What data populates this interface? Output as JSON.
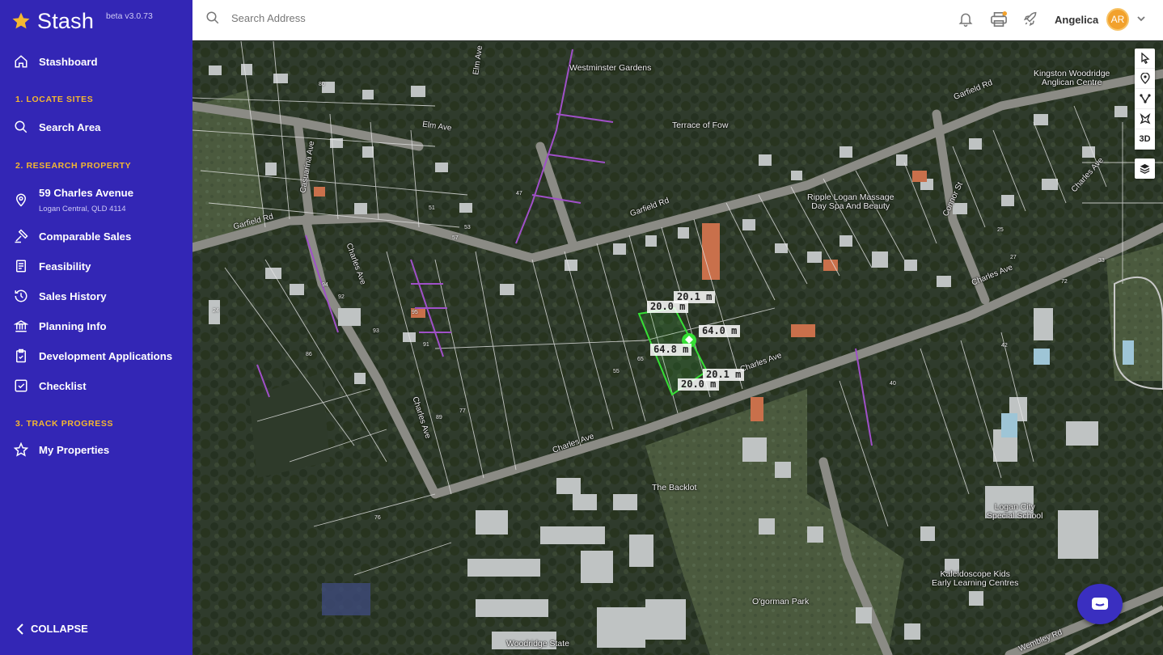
{
  "brand": {
    "name": "Stash",
    "version": "beta v3.0.73"
  },
  "sidebar": {
    "dashboard": "Stashboard",
    "section1": "1. LOCATE SITES",
    "search_area": "Search Area",
    "section2": "2. RESEARCH PROPERTY",
    "property_title": "59 Charles Avenue",
    "property_sub": "Logan Central, QLD 4114",
    "comparable": "Comparable Sales",
    "feasibility": "Feasibility",
    "sales_history": "Sales History",
    "planning": "Planning Info",
    "dev_apps": "Development Applications",
    "checklist": "Checklist",
    "section3": "3. TRACK PROGRESS",
    "my_properties": "My Properties",
    "collapse": "COLLAPSE"
  },
  "topbar": {
    "search_placeholder": "Search Address",
    "user_name": "Angelica",
    "avatar_initials": "AR"
  },
  "map": {
    "toolbar": {
      "three_d": "3D"
    },
    "measurements": {
      "top": "20.1 m",
      "top_left": "20.0 m",
      "right": "64.0 m",
      "left": "64.8 m",
      "bottom_right": "20.1 m",
      "bottom": "20.0 m"
    },
    "roads": {
      "elm_ave": "Elm Ave",
      "elm_ave_v": "Elm Ave",
      "casuarina": "Casuarina Ave",
      "garfield_rd_left": "Garfield Rd",
      "garfield_rd_mid": "Garfield Rd",
      "garfield_rd_right": "Garfield Rd",
      "charles_ave_v": "Charles Ave",
      "charles_ave_v2": "Charles Ave",
      "charles_ave_main": "Charles Ave",
      "charles_ave_mid": "Charles Ave",
      "charles_ave_right": "Charles Ave",
      "charles_ave_far": "Charles Ave",
      "connor_st": "Connor St",
      "wembley_rd": "Wembley Rd"
    },
    "pois": {
      "westminster": "Westminster Gardens",
      "terrace": "Terrace of Fow",
      "ripple": "Ripple Logan Massage\nDay Spa And Beauty",
      "kingston": "Kingston Woodridge\nAnglican Centre",
      "backlot": "The Backlot",
      "special_school": "Logan City\nSpecial School",
      "kaleidoscope": "Kaleidoscope Kids\nEarly Learning Centres",
      "ogorman": "O'gorman Park",
      "woodridge": "Woodridge State"
    },
    "lot_numbers": [
      "57",
      "53",
      "55",
      "65",
      "63",
      "86",
      "89",
      "77",
      "72",
      "24",
      "94",
      "93",
      "95",
      "92",
      "91",
      "40",
      "42",
      "25",
      "27",
      "33",
      "76",
      "80",
      "47",
      "51"
    ]
  },
  "colors": {
    "sidebar": "#3326b5",
    "accent": "#f4b731",
    "parcel": "#36e036",
    "boundary": "#a050c8"
  },
  "icons": [
    "star-logo-icon",
    "home-icon",
    "search-icon",
    "location-pin-icon",
    "comparable-icon",
    "feasibility-icon",
    "history-icon",
    "bank-icon",
    "clipboard-icon",
    "checkbox-icon",
    "star-outline-icon",
    "chevron-left-icon",
    "bell-icon",
    "printer-icon",
    "rocket-icon",
    "chevron-down-icon",
    "cursor-icon",
    "pin-icon",
    "polyline-icon",
    "polygon-icon",
    "layers-icon",
    "chat-icon"
  ]
}
